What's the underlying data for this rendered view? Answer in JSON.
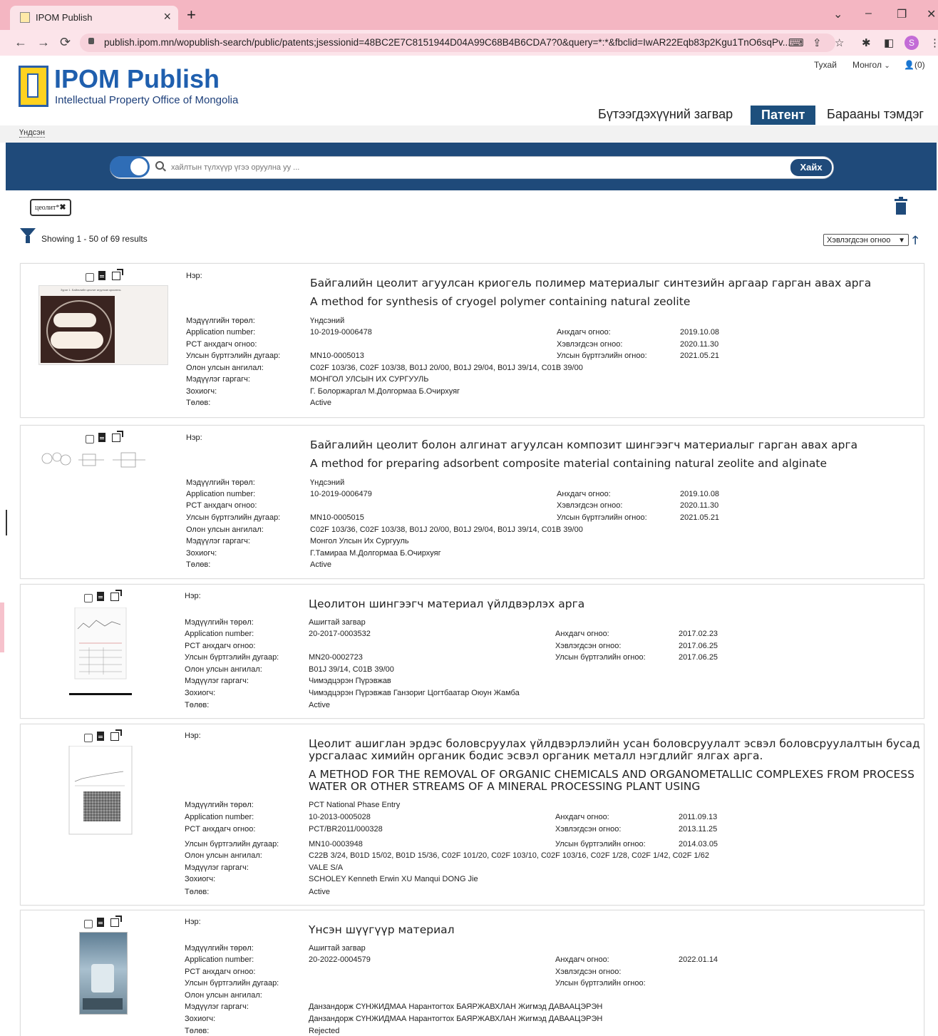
{
  "browser": {
    "tab_title": "IPOM Publish",
    "tab_close": "×",
    "new_tab": "+",
    "url": "publish.ipom.mn/wopublish-search/public/patents;jsessionid=48BC2E7C8151944D04A99C68B4B6CDA7?0&query=*:*&fbclid=IwAR22Eqb83p2Kgu1TnO6sqPv...",
    "profile_initial": "S",
    "icons": [
      "back-icon",
      "forward-icon",
      "reload-icon",
      "lock-icon",
      "translate-icon",
      "share-icon",
      "star-icon",
      "extensions-icon",
      "sidebar-icon",
      "menu-icon"
    ]
  },
  "header": {
    "logo_title": "IPOM Publish",
    "logo_subtitle": "Intellectual Property Office of Mongolia",
    "top_links": {
      "about": "Тухай",
      "language": "Монгол",
      "user_count": "(0)"
    },
    "nav": {
      "design": "Бүтээгдэхүүний загвар",
      "patent": "Патент",
      "trademark": "Барааны тэмдэг"
    },
    "breadcrumb": "Үндсэн"
  },
  "search": {
    "placeholder": "хайлтын түлхүүр үгээ оруулна уу ...",
    "button": "Хайх"
  },
  "filter": {
    "tag_label": "цеолит*",
    "tag_remove": "✖",
    "showing": "Showing 1 - 50 of 69 results",
    "sort_value": "Хэвлэгдсэн огноо",
    "sort_dir": "🡑"
  },
  "labels": {
    "name": "Нэр:",
    "type": "Мэдүүлгийн төрөл:",
    "app_no": "Application number:",
    "pct_date": "PCT анхдагч огноо:",
    "reg_no": "Улсын бүртгэлийн дугаар:",
    "ipc": "Олон улсын ангилал:",
    "applicant": "Мэдүүлэг гаргагч:",
    "inventor": "Зохиогч:",
    "status": "Төлөв:",
    "filing_date": "Анхдагч огноо:",
    "pub_date": "Хэвлэгдсэн огноо:",
    "reg_date": "Улсын бүртгэлийн огноо:"
  },
  "results": [
    {
      "title_mn": "Байгалийн цеолит агуулсан криогель полимер материалыг синтезийн аргаар гарган авах арга",
      "title_en": "A method for synthesis of cryogel polymer containing natural zeolite",
      "type": "Үндсэний",
      "app_no": "10-2019-0006478",
      "pct_date": "",
      "reg_no": "MN10-0005013",
      "ipc": "C02F 103/36, C02F 103/38, B01J 20/00, B01J 29/04, B01J 39/14, C01B 39/00",
      "applicant": "МОНГОЛ УЛСЫН ИХ СУРГУУЛЬ",
      "inventor": "Г. Болоржаргал М.Долгормаа Б.Очирхуяг",
      "status": "Active",
      "filing_date": "2019.10.08",
      "pub_date": "2020.11.30",
      "reg_date": "2021.05.21",
      "thumb_caption": "Зураг 1. Байгалийн цеолит агуулсан криогель"
    },
    {
      "title_mn": "Байгалийн цеолит болон алгинат агуулсан композит шингээгч материалыг гарган авах арга",
      "title_en": "A method for preparing adsorbent composite material containing natural zeolite and alginate",
      "type": "Үндсэний",
      "app_no": "10-2019-0006479",
      "pct_date": "",
      "reg_no": "MN10-0005015",
      "ipc": "C02F 103/36, C02F 103/38, B01J 20/00, B01J 29/04, B01J 39/14, C01B 39/00",
      "applicant": "Монгол Улсын Их Сургууль",
      "inventor": "Г.Тамираа М.Долгормаа Б.Очирхуяг",
      "status": "Active",
      "filing_date": "2019.10.08",
      "pub_date": "2020.11.30",
      "reg_date": "2021.05.21"
    },
    {
      "title_mn": "Цеолитон шингээгч материал үйлдвэрлэх арга",
      "type": "Ашигтай загвар",
      "app_no": "20-2017-0003532",
      "pct_date": "",
      "reg_no": "MN20-0002723",
      "ipc": "B01J 39/14, C01B 39/00",
      "applicant": "Чимэдцэрэн Пүрэвжав",
      "inventor": "Чимэдцэрэн Пүрэвжав Ганзориг Цогтбаатар Оюун Жамба",
      "status": "Active",
      "filing_date": "2017.02.23",
      "pub_date": "2017.06.25",
      "reg_date": "2017.06.25"
    },
    {
      "title_mn_1": "Цеолит ашиглан эрдэс боловсруулах үйлдвэрлэлийн усан боловсруулалт эсвэл боловсруулалтын бусад",
      "title_mn_2": "урсгалаас химийн органик бодис эсвэл органик металл нэгдлийг ялгах арга.",
      "title_en_1": "A METHOD FOR THE REMOVAL OF ORGANIC CHEMICALS AND ORGANOMETALLIC COMPLEXES FROM PROCESS",
      "title_en_2": "WATER OR OTHER STREAMS OF A MINERAL PROCESSING PLANT USING",
      "type": "PCT National Phase Entry",
      "app_no": "10-2013-0005028",
      "pct_date": "PCT/BR2011/000328",
      "reg_no": "MN10-0003948",
      "ipc": "C22B 3/24, B01D 15/02, B01D 15/36, C02F 101/20, C02F 103/10, C02F 103/16, C02F 1/28, C02F 1/42, C02F 1/62",
      "applicant": "VALE S/A",
      "inventor": "SCHOLEY Kenneth Erwin XU Manqui DONG Jie",
      "status": "Active",
      "filing_date": "2011.09.13",
      "pub_date": "2013.11.25",
      "reg_date": "2014.03.05"
    },
    {
      "title_mn": "Үнсэн шүүгүүр материал",
      "type": "Ашигтай загвар",
      "app_no": "20-2022-0004579",
      "pct_date": "",
      "reg_no": "",
      "ipc": "",
      "applicant": "Данзандорж СҮНЖИДМАА Нарантогтох БАЯРЖАВХЛАН Жигмэд ДАВААЦЭРЭН",
      "inventor": "Данзандорж СҮНЖИДМАА Нарантогтох БАЯРЖАВХЛАН Жигмэд ДАВААЦЭРЭН",
      "status": "Rejected",
      "filing_date": "2022.01.14",
      "pub_date": "",
      "reg_date": ""
    }
  ],
  "colors": {
    "brand_blue": "#1f4a7a",
    "tab_pink": "#f4b6c2",
    "logo_yellow": "#ffd21f"
  }
}
